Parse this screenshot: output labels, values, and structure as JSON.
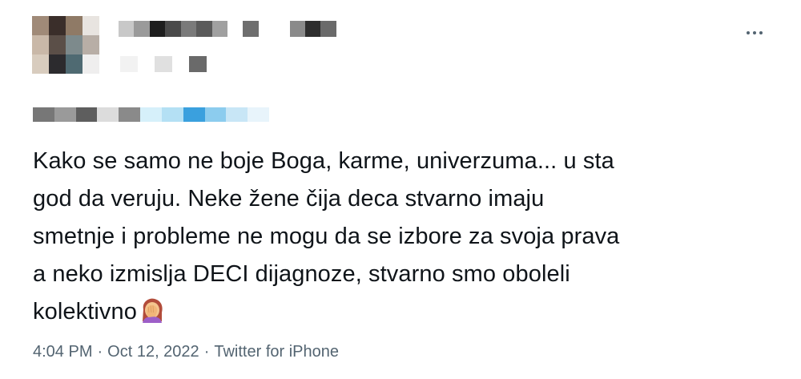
{
  "tweet": {
    "text_lines": [
      "Kako se samo ne boje Boga, karme, univerzuma... u sta",
      "god da veruju. Neke žene čija deca stvarno imaju",
      "smetnje i probleme ne mogu da se izbore za svoja prava",
      "a neko izmislja DECI dijagnoze, stvarno smo oboleli",
      "kolektivno"
    ],
    "emoji": "woman-facepalming-emoji",
    "time": "4:04 PM",
    "separator": "·",
    "date": "Oct 12, 2022",
    "source": "Twitter for iPhone"
  },
  "author": {
    "avatar_pixels": [
      "#a08a78",
      "#3a2e2a",
      "#8f7a66",
      "#e8e4e0",
      "#c9b8a8",
      "#5b4f48",
      "#7d8a8c",
      "#b8aea6",
      "#d8ccbe",
      "#2c2b2e",
      "#4f6a72",
      "#efeeee"
    ],
    "name_pixels": [
      "#c8c8c8",
      "#9a9a9a",
      "#1e1e1e",
      "#4a4a4a",
      "#7a7a7a",
      "#5a5a5a",
      "#a0a0a0",
      "#ffffff",
      "#6e6e6e",
      "#ffffff",
      "#ffffff",
      "#8a8a8a",
      "#2e2e2e",
      "#6a6a6a"
    ],
    "handle_pixels": [
      "#f2f2f2",
      "#ffffff",
      "#e0e0e0",
      "#ffffff",
      "#6a6a6a"
    ],
    "mention_pixels": [
      "#777777",
      "#9a9a9a",
      "#5e5e5e",
      "#dcdcdc",
      "#8a8a8a",
      "#d6f0fa",
      "#b4e0f4",
      "#3aa0de",
      "#8cccee",
      "#c8e6f6",
      "#e8f4fb"
    ]
  },
  "more_icon": "more-horizontal-icon",
  "colors": {
    "text": "#0f1419",
    "meta": "#536471",
    "background": "#ffffff"
  }
}
